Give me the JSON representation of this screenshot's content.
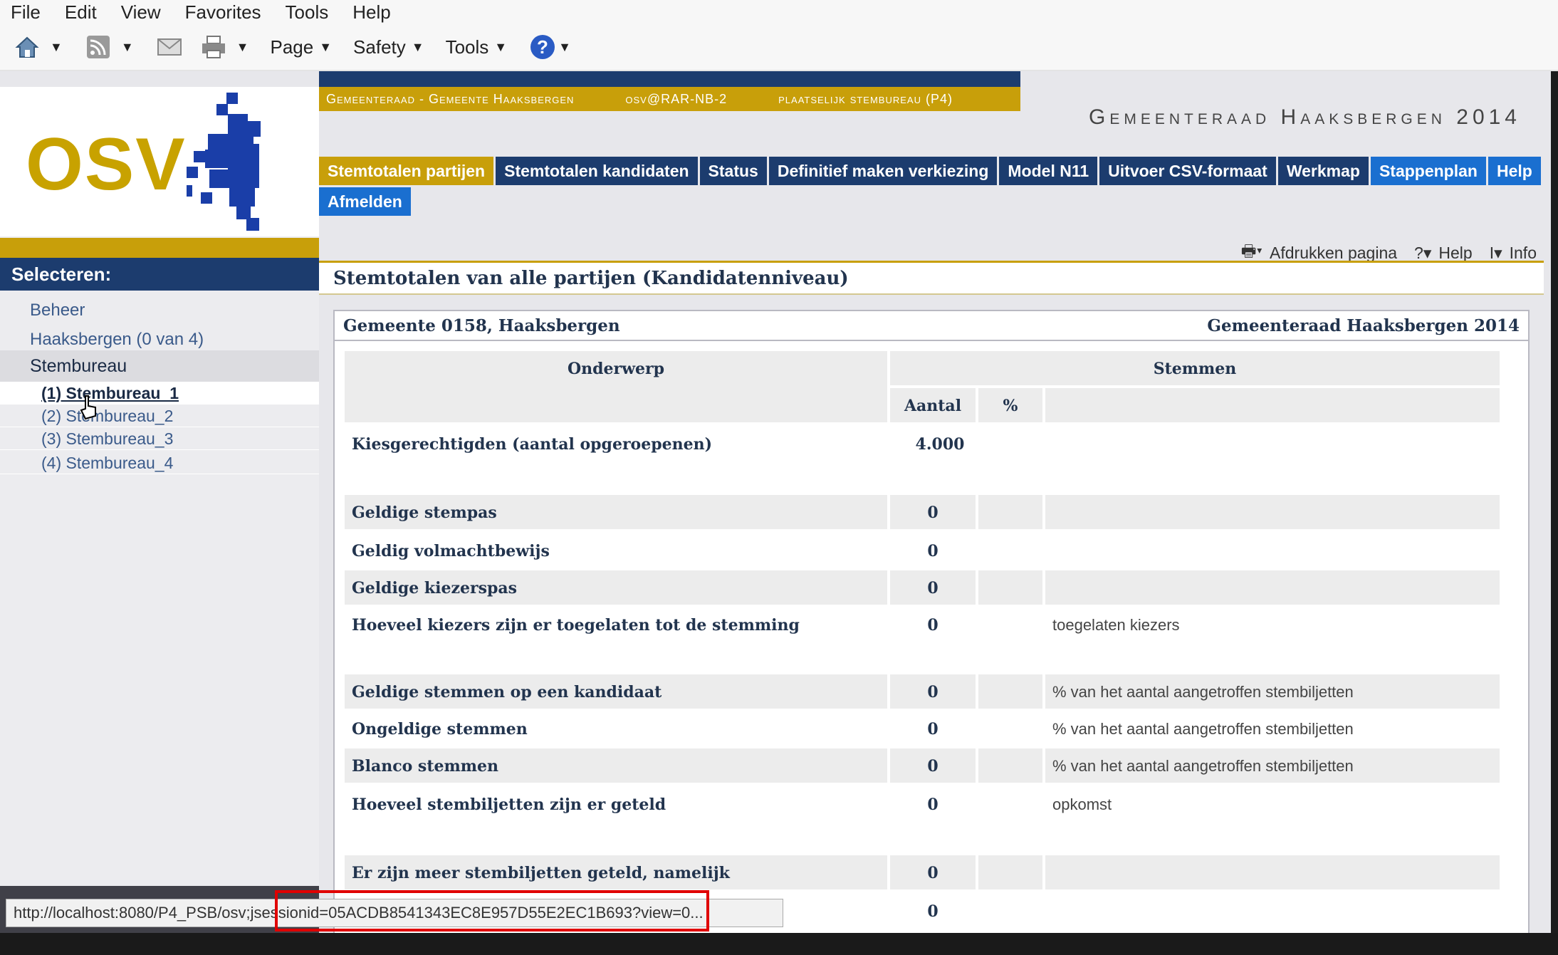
{
  "browser": {
    "menu": [
      "File",
      "Edit",
      "View",
      "Favorites",
      "Tools",
      "Help"
    ],
    "command_bar": {
      "page": "Page",
      "safety": "Safety",
      "tools": "Tools"
    },
    "status_url": "http://localhost:8080/P4_PSB/osv;jsessionid=05ACDB8541343EC8E957D55E2EC1B693?view=0..."
  },
  "app": {
    "logo_text": "OSV",
    "context": {
      "left": "Gemeenteraad - Gemeente Haaksbergen",
      "user": "osv@RAR-NB-2",
      "role": "plaatselijk stembureau (P4)"
    },
    "title": "Gemeenteraad Haaksbergen 2014",
    "tabs": [
      {
        "label": "Stemtotalen partijen",
        "active": true
      },
      {
        "label": "Stemtotalen kandidaten"
      },
      {
        "label": "Status"
      },
      {
        "label": "Definitief maken verkiezing"
      },
      {
        "label": "Model N11"
      },
      {
        "label": "Uitvoer CSV-formaat"
      },
      {
        "label": "Werkmap"
      },
      {
        "label": "Stappenplan"
      },
      {
        "label": "Help"
      }
    ],
    "logout": "Afmelden",
    "print_bar": {
      "print": "Afdrukken pagina",
      "help": "Help",
      "info": "Info"
    }
  },
  "sidebar": {
    "header": "Selecteren:",
    "items": [
      "Beheer",
      "Haaksbergen (0 van 4)"
    ],
    "group": "Stembureau",
    "subitems": [
      "(1) Stembureau_1",
      "(2) Stembureau_2",
      "(3) Stembureau_3",
      "(4) Stembureau_4"
    ]
  },
  "page": {
    "title": "Stemtotalen van alle partijen (Kandidatenniveau)",
    "panel_left": "Gemeente 0158, Haaksbergen",
    "panel_right": "Gemeenteraad Haaksbergen 2014",
    "col_subject": "Onderwerp",
    "col_votes": "Stemmen",
    "col_count": "Aantal",
    "col_pct": "%",
    "rows": [
      {
        "label": "Kiesgerechtigden (aantal opgeroepenen)",
        "value": "4.000",
        "note": ""
      },
      {
        "label": "Geldige stempas",
        "value": "0",
        "note": ""
      },
      {
        "label": "Geldig volmachtbewijs",
        "value": "0",
        "note": ""
      },
      {
        "label": "Geldige kiezerspas",
        "value": "0",
        "note": ""
      },
      {
        "label": "Hoeveel kiezers zijn er toegelaten tot de stemming",
        "value": "0",
        "note": "toegelaten kiezers"
      },
      {
        "label": "Geldige stemmen op een kandidaat",
        "value": "0",
        "note": "% van het aantal aangetroffen stembiljetten"
      },
      {
        "label": "Ongeldige stemmen",
        "value": "0",
        "note": "% van het aantal aangetroffen stembiljetten"
      },
      {
        "label": "Blanco stemmen",
        "value": "0",
        "note": "% van het aantal aangetroffen stembiljetten"
      },
      {
        "label": "Hoeveel stembiljetten zijn er geteld",
        "value": "0",
        "note": "opkomst"
      },
      {
        "label": "Er zijn meer stembiljetten geteld, namelijk",
        "value": "0",
        "note": ""
      },
      {
        "label": "",
        "value": "0",
        "note": ""
      }
    ]
  },
  "colors": {
    "navy": "#1c3c6e",
    "gold": "#c89f0a",
    "blue": "#1a6fd0",
    "highlight": "#e00000"
  }
}
